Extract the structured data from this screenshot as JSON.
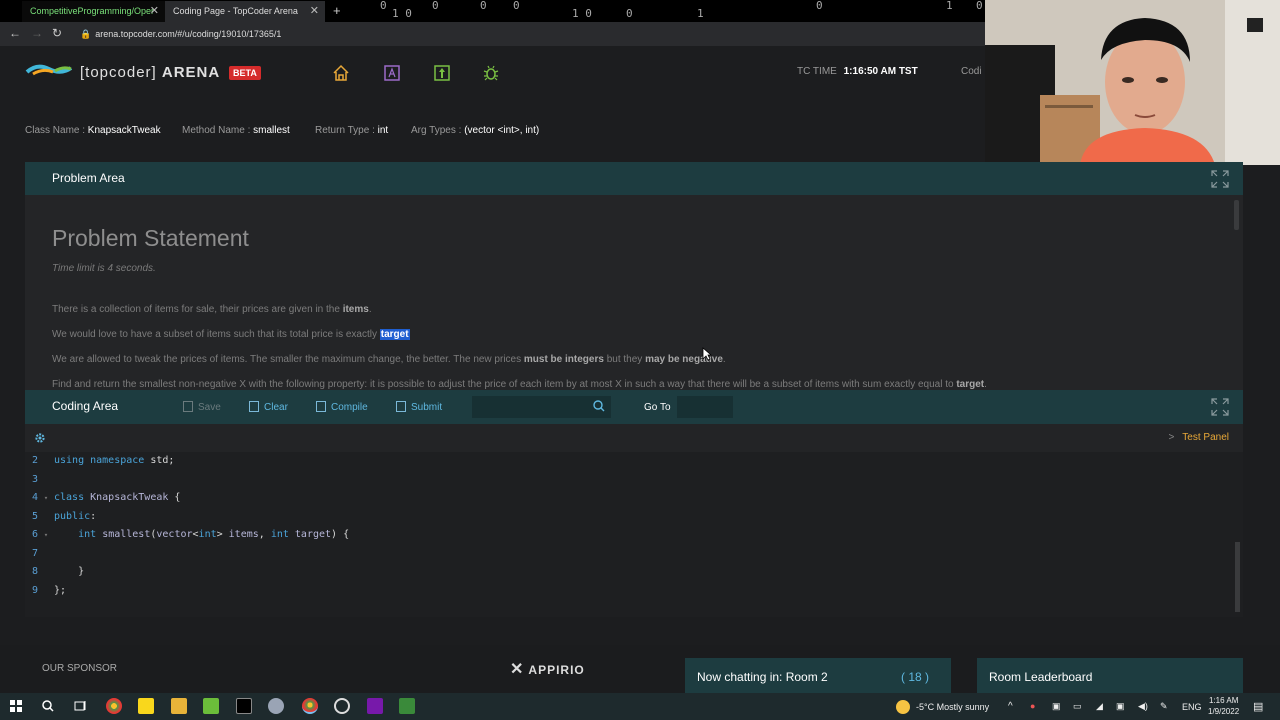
{
  "browser": {
    "tabs": [
      {
        "title": "CompetitiveProgramming/Oper"
      },
      {
        "title": "Coding Page - TopCoder Arena"
      }
    ],
    "matrix_digits": [
      "0",
      "1 0",
      "0",
      "0",
      "0",
      "1 0",
      "0",
      "1",
      "0",
      "1",
      "0"
    ],
    "url": "arena.topcoder.com/#/u/coding/19010/17365/1"
  },
  "header": {
    "brand": "[topcoder]",
    "brand_suffix": "ARENA",
    "beta": "BETA",
    "tc_time_label": "TC TIME",
    "tc_time_value": "1:16:50 AM TST",
    "cut_label": "Codi"
  },
  "class_info": {
    "class_name_label": "Class Name :",
    "class_name": "KnapsackTweak",
    "method_name_label": "Method Name :",
    "method_name": "smallest",
    "return_type_label": "Return Type :",
    "return_type": "int",
    "arg_types_label": "Arg Types :",
    "arg_types": "(vector <int>, int)"
  },
  "problem": {
    "area_title": "Problem Area",
    "statement_title": "Problem Statement",
    "time_limit": "Time limit is 4 seconds.",
    "l1a": "There is a collection of items for sale, their prices are given in the ",
    "l1b": "items",
    "l1c": ".",
    "l2a": "We would love to have a subset of items such that its total price is exactly ",
    "l2b": "target",
    "l3a": "We are allowed to tweak the prices of items. The smaller the maximum change, the better. The new prices ",
    "l3b": "must be integers",
    "l3c": " but they ",
    "l3d": "may be negative",
    "l3e": ".",
    "l4a": "Find and return the smallest non-negative X with the following property: it is possible to adjust the price of each item by at most X in such a way that there will be a subset of items with sum exactly equal to ",
    "l4b": "target",
    "l4c": "."
  },
  "coding": {
    "area_title": "Coding Area",
    "save": "Save",
    "clear": "Clear",
    "compile": "Compile",
    "submit": "Submit",
    "goto": "Go To",
    "test_panel": "Test Panel",
    "lines": [
      {
        "n": "2",
        "fold": "",
        "code": [
          [
            "kw",
            "using namespace "
          ],
          [
            "tx",
            "std;"
          ]
        ]
      },
      {
        "n": "3",
        "fold": "",
        "code": []
      },
      {
        "n": "4",
        "fold": "▾",
        "code": [
          [
            "kw",
            "class "
          ],
          [
            "id",
            "KnapsackTweak "
          ],
          [
            "tx",
            "{"
          ]
        ]
      },
      {
        "n": "5",
        "fold": "",
        "code": [
          [
            "kw",
            "public"
          ],
          [
            "tx",
            ":"
          ]
        ]
      },
      {
        "n": "6",
        "fold": "▾",
        "code": [
          [
            "tx",
            "    "
          ],
          [
            "kw",
            "int "
          ],
          [
            "id",
            "smallest"
          ],
          [
            "tx",
            "("
          ],
          [
            "id",
            "vector"
          ],
          [
            "tx",
            "<"
          ],
          [
            "kw",
            "int"
          ],
          [
            "tx",
            "> "
          ],
          [
            "id",
            "items"
          ],
          [
            "tx",
            ", "
          ],
          [
            "kw",
            "int "
          ],
          [
            "id",
            "target"
          ],
          [
            "tx",
            ") {"
          ]
        ]
      },
      {
        "n": "7",
        "fold": "",
        "code": []
      },
      {
        "n": "8",
        "fold": "",
        "code": [
          [
            "tx",
            "    }"
          ]
        ]
      },
      {
        "n": "9",
        "fold": "",
        "code": [
          [
            "tx",
            "};"
          ]
        ]
      }
    ]
  },
  "footer": {
    "sponsor": "OUR SPONSOR",
    "sponsor_name": "APPIRIO",
    "chat_label": "Now chatting in: Room 2",
    "chat_count": "( 18 )",
    "leaderboard": "Room Leaderboard"
  },
  "taskbar": {
    "weather": "-5°C  Mostly sunny",
    "lang": "ENG",
    "time": "1:16 AM",
    "date": "1/9/2022"
  },
  "colors": {
    "accent": "#5fb8e0",
    "panel_header": "#1d3c40",
    "test_panel": "#e8a838",
    "beta": "#d52b2b"
  }
}
